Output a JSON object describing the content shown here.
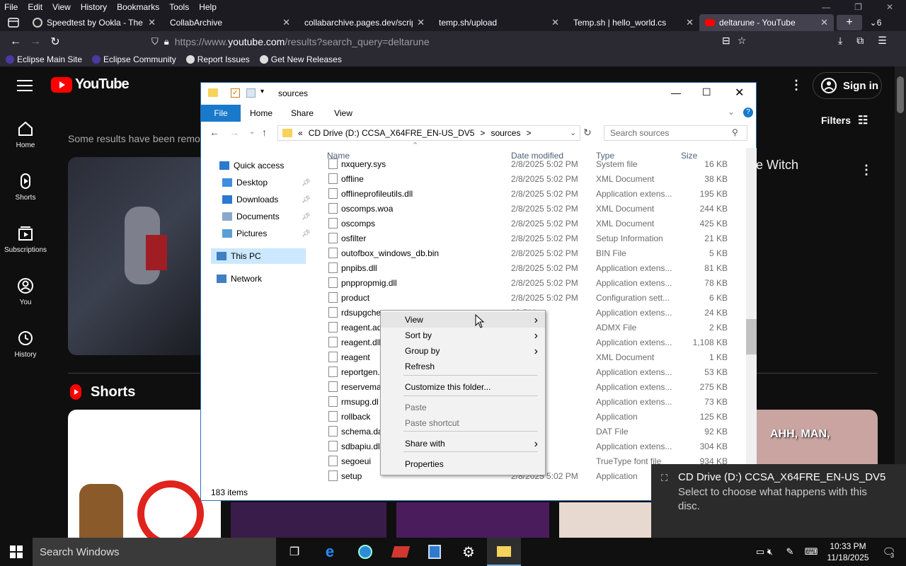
{
  "browser": {
    "menu": [
      "File",
      "Edit",
      "View",
      "History",
      "Bookmarks",
      "Tools",
      "Help"
    ],
    "tabs": [
      {
        "title": "Speedtest by Ookla - The",
        "active": false,
        "icon_color": "#1b1b1b"
      },
      {
        "title": "CollabArchive",
        "active": false,
        "icon_color": ""
      },
      {
        "title": "collabarchive.pages.dev/scrip",
        "active": false,
        "icon_color": ""
      },
      {
        "title": "temp.sh/upload",
        "active": false,
        "icon_color": ""
      },
      {
        "title": "Temp.sh | hello_world.cs",
        "active": false,
        "icon_color": ""
      },
      {
        "title": "deltarune - YouTube",
        "active": true,
        "icon_color": "#ff0000"
      }
    ],
    "tab_count": "6",
    "url_prefix": "https://www.",
    "url_domain": "youtube.com",
    "url_path": "/results?search_query=deltarune",
    "bookmarks": [
      "Eclipse Main Site",
      "Eclipse Community",
      "Report Issues",
      "Get New Releases"
    ]
  },
  "youtube": {
    "logo": "YouTube",
    "sign_in": "Sign in",
    "filters": "Filters",
    "notice": "Some results have been remov",
    "result_title_fragment": "e Witch",
    "shorts_heading": "Shorts",
    "short_caption": "AHH, MAN,",
    "sidebar": [
      "Home",
      "Shorts",
      "Subscriptions",
      "You",
      "History"
    ]
  },
  "explorer": {
    "title": "sources",
    "ribbon_tabs": [
      "File",
      "Home",
      "Share",
      "View"
    ],
    "breadcrumb": [
      "«",
      "CD Drive (D:) CCSA_X64FRE_EN-US_DV5",
      ">",
      "sources",
      ">"
    ],
    "search_placeholder": "Search sources",
    "nav": [
      {
        "label": "Quick access",
        "pinned": false
      },
      {
        "label": "Desktop",
        "pinned": true
      },
      {
        "label": "Downloads",
        "pinned": true
      },
      {
        "label": "Documents",
        "pinned": true
      },
      {
        "label": "Pictures",
        "pinned": true
      },
      {
        "label": "This PC",
        "pinned": false,
        "selected": true
      },
      {
        "label": "Network",
        "pinned": false
      }
    ],
    "columns": [
      "Name",
      "Date modified",
      "Type",
      "Size"
    ],
    "rows": [
      {
        "name": "nxquery.sys",
        "date": "2/8/2025 5:02 PM",
        "type": "System file",
        "size": "16 KB"
      },
      {
        "name": "offline",
        "date": "2/8/2025 5:02 PM",
        "type": "XML Document",
        "size": "38 KB"
      },
      {
        "name": "offlineprofileutils.dll",
        "date": "2/8/2025 5:02 PM",
        "type": "Application extens...",
        "size": "195 KB"
      },
      {
        "name": "oscomps.woa",
        "date": "2/8/2025 5:02 PM",
        "type": "XML Document",
        "size": "244 KB"
      },
      {
        "name": "oscomps",
        "date": "2/8/2025 5:02 PM",
        "type": "XML Document",
        "size": "425 KB"
      },
      {
        "name": "osfilter",
        "date": "2/8/2025 5:02 PM",
        "type": "Setup Information",
        "size": "21 KB"
      },
      {
        "name": "outofbox_windows_db.bin",
        "date": "2/8/2025 5:02 PM",
        "type": "BIN File",
        "size": "5 KB"
      },
      {
        "name": "pnpibs.dll",
        "date": "2/8/2025 5:02 PM",
        "type": "Application extens...",
        "size": "81 KB"
      },
      {
        "name": "pnppropmig.dll",
        "date": "2/8/2025 5:02 PM",
        "type": "Application extens...",
        "size": "78 KB"
      },
      {
        "name": "product",
        "date": "2/8/2025 5:02 PM",
        "type": "Configuration sett...",
        "size": "6 KB"
      },
      {
        "name": "rdsupgche",
        "date": "02 PM",
        "type": "Application extens...",
        "size": "24 KB"
      },
      {
        "name": "reagent.ad",
        "date": "02 PM",
        "type": "ADMX File",
        "size": "2 KB"
      },
      {
        "name": "reagent.dll",
        "date": "02 PM",
        "type": "Application extens...",
        "size": "1,108 KB"
      },
      {
        "name": "reagent",
        "date": "02 PM",
        "type": "XML Document",
        "size": "1 KB"
      },
      {
        "name": "reportgen.",
        "date": "02 PM",
        "type": "Application extens...",
        "size": "53 KB"
      },
      {
        "name": "reservema",
        "date": "02 PM",
        "type": "Application extens...",
        "size": "275 KB"
      },
      {
        "name": "rmsupg.dl",
        "date": "02 PM",
        "type": "Application extens...",
        "size": "73 KB"
      },
      {
        "name": "rollback",
        "date": "02 PM",
        "type": "Application",
        "size": "125 KB"
      },
      {
        "name": "schema.da",
        "date": "02 PM",
        "type": "DAT File",
        "size": "92 KB"
      },
      {
        "name": "sdbapiu.dl",
        "date": "02 PM",
        "type": "Application extens...",
        "size": "304 KB"
      },
      {
        "name": "segoeui",
        "date": "02 PM",
        "type": "TrueType font file",
        "size": "934 KB"
      },
      {
        "name": "setup",
        "date": "2/8/2025 5:02 PM",
        "type": "Application",
        "size": ""
      }
    ],
    "item_count": "183 items"
  },
  "context_menu": [
    {
      "label": "View",
      "submenu": true,
      "disabled": false,
      "highlight": true
    },
    {
      "label": "Sort by",
      "submenu": true,
      "disabled": false
    },
    {
      "label": "Group by",
      "submenu": true,
      "disabled": false
    },
    {
      "label": "Refresh",
      "submenu": false,
      "disabled": false
    },
    {
      "label": "Customize this folder...",
      "submenu": false,
      "disabled": false
    },
    {
      "label": "Paste",
      "submenu": false,
      "disabled": true
    },
    {
      "label": "Paste shortcut",
      "submenu": false,
      "disabled": true
    },
    {
      "label": "Share with",
      "submenu": true,
      "disabled": false
    },
    {
      "label": "Properties",
      "submenu": false,
      "disabled": false
    }
  ],
  "toast": {
    "title": "CD Drive (D:) CCSA_X64FRE_EN-US_DV5",
    "body": "Select to choose what happens with this disc."
  },
  "taskbar": {
    "search_placeholder": "Search Windows",
    "time": "10:33 PM",
    "date": "11/18/2025",
    "notification_count": "3"
  }
}
